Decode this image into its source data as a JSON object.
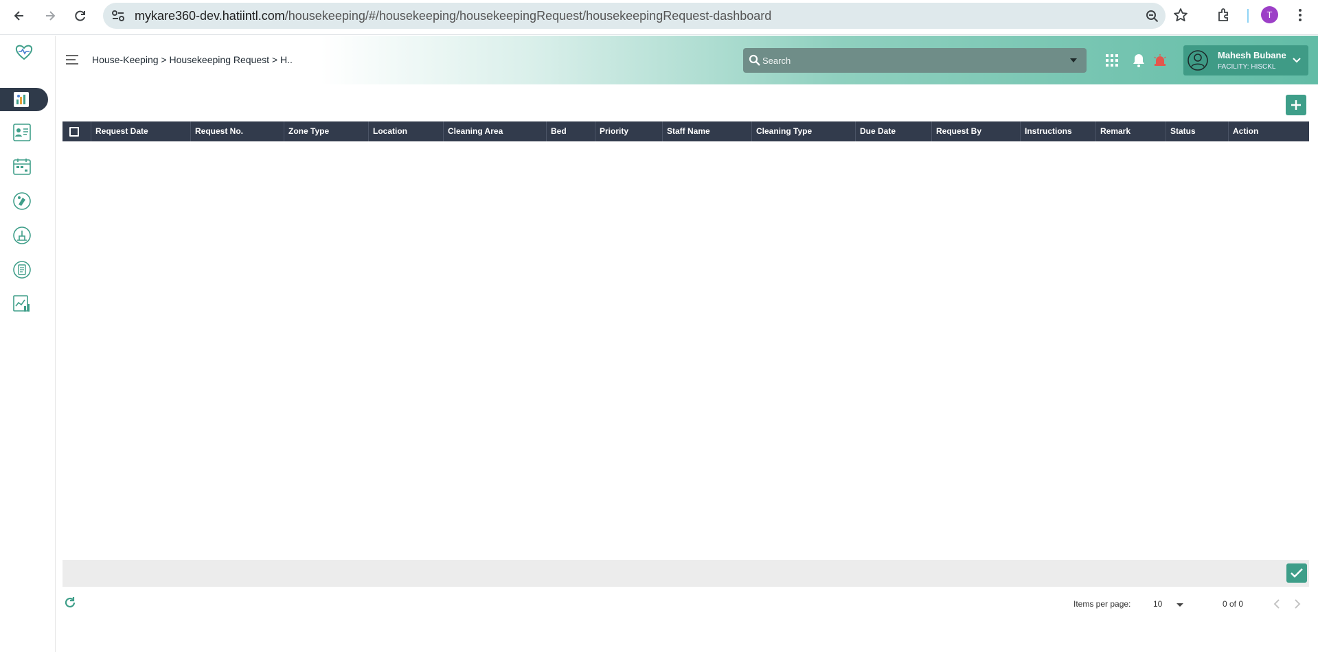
{
  "browser": {
    "url_host": "mykare360-dev.hatiintl.com",
    "url_path": "/housekeeping/#/housekeeping/housekeepingRequest/housekeepingRequest-dashboard",
    "profile_initial": "T"
  },
  "sidebar": {
    "items": [
      {
        "name": "housekeeping-dashboard-icon",
        "active": true
      },
      {
        "name": "staff-assign-icon"
      },
      {
        "name": "schedule-icon"
      },
      {
        "name": "cleaning-service-icon"
      },
      {
        "name": "cleaning-task-icon"
      },
      {
        "name": "checklist-icon"
      },
      {
        "name": "reports-icon"
      }
    ]
  },
  "header": {
    "breadcrumb": "House-Keeping > Housekeeping Request > H..",
    "search_placeholder": "Search",
    "user_name": "Mahesh Bubane",
    "facility": "FACILITY: HISCKL"
  },
  "table": {
    "columns": [
      "Request Date",
      "Request No.",
      "Zone Type",
      "Location",
      "Cleaning Area",
      "Bed",
      "Priority",
      "Staff Name",
      "Cleaning Type",
      "Due Date",
      "Request By",
      "Instructions",
      "Remark",
      "Status",
      "Action"
    ],
    "rows": []
  },
  "pagination": {
    "items_per_page_label": "Items per page:",
    "items_per_page": "10",
    "range": "0 of 0"
  },
  "colors": {
    "accent": "#3e9e89",
    "table_header": "#323b4c",
    "sidebar_active": "#2f3a4a"
  }
}
